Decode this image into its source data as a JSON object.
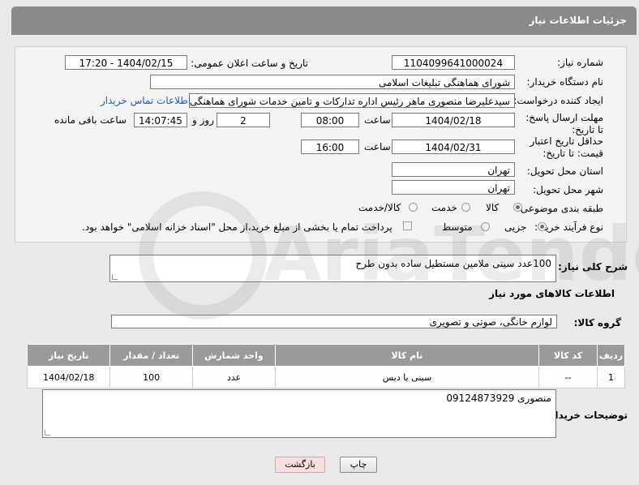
{
  "header": {
    "title": "جزئیات اطلاعات نیاز"
  },
  "form": {
    "need_number_label": "شماره نیاز:",
    "need_number": "1104099641000024",
    "announce_label": "تاریخ و ساعت اعلان عمومی:",
    "announce_value": "1404/02/15 - 17:20",
    "buyer_org_label": "نام دستگاه خریدار:",
    "buyer_org": "شورای هماهنگی تبلیغات اسلامی",
    "creator_label": "ایجاد کننده درخواست:",
    "creator": "سیدعلیرضا منصوری ماهر رئیس اداره تداركات و تامین خدمات  شورای هماهنگی",
    "contact_link": "اطلاعات تماس خریدار",
    "reply_deadline_label": "مهلت ارسال پاسخ: تا تاریخ:",
    "reply_date": "1404/02/18",
    "time_label": "ساعت",
    "reply_time": "08:00",
    "days_value": "2",
    "days_label": "روز و",
    "remaining_time": "14:07:45",
    "remaining_label": "ساعت باقی مانده",
    "price_deadline_label": "حداقل تاریخ اعتبار قیمت: تا تاریخ:",
    "price_date": "1404/02/31",
    "price_time": "16:00",
    "province_label": "استان محل تحویل:",
    "province": "تهران",
    "city_label": "شهر محل تحویل:",
    "city": "تهران",
    "category_label": "طبقه بندی موضوعی:",
    "category_options": [
      "کالا",
      "خدمت",
      "کالا/خدمت"
    ],
    "purchase_type_label": "نوع فرآیند خرید :",
    "purchase_options": [
      "جزیی",
      "متوسط"
    ],
    "payment_note": "پرداخت تمام یا بخشی از مبلغ خرید،از محل \"اسناد خزانه اسلامی\" خواهد بود."
  },
  "description": {
    "label": "شرح کلی نیاز:",
    "value": "100عدد سینی ملامین مستطیل ساده بدون طرح"
  },
  "goods_info": {
    "title": "اطلاعات کالاهای مورد نیاز"
  },
  "goods_group": {
    "label": "گروه کالا:",
    "value": "لوازم خانگی، صوتی و تصویری"
  },
  "table": {
    "headers": [
      "ردیف",
      "کد کالا",
      "نام کالا",
      "واحد شمارش",
      "تعداد / مقدار",
      "تاریخ نیاز"
    ],
    "rows": [
      [
        "1",
        "--",
        "سینی یا دیس",
        "عدد",
        "100",
        "1404/02/18"
      ]
    ]
  },
  "buyer_notes": {
    "label": "توضیحات خریدار:",
    "value": "منصوری 09124873929"
  },
  "buttons": {
    "print": "چاپ",
    "back": "بازگشت"
  },
  "watermark": {
    "text": "AriaTender.neT"
  }
}
